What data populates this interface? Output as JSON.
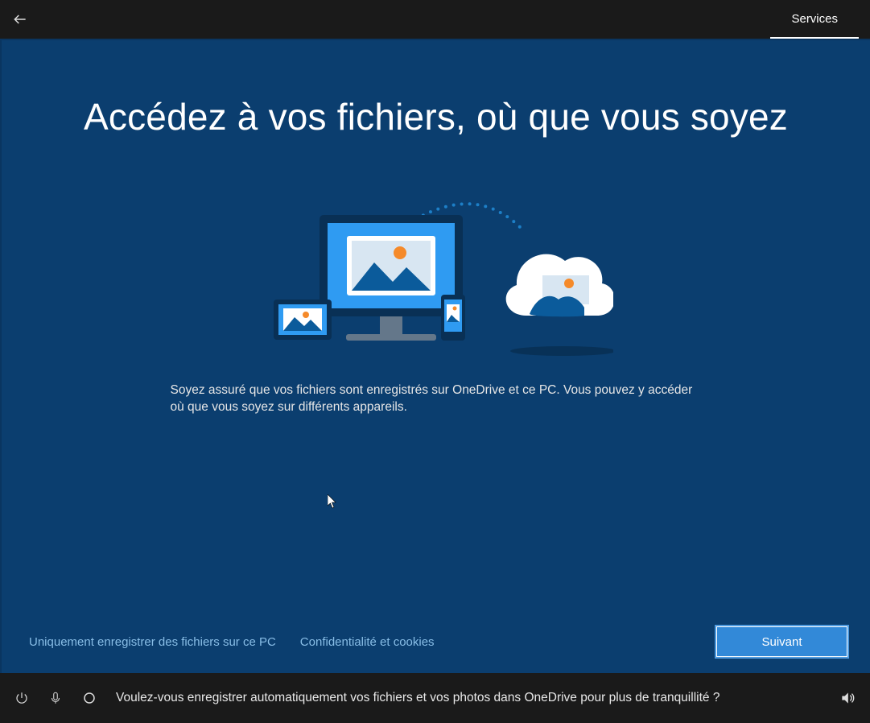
{
  "topbar": {
    "tab_label": "Services"
  },
  "main": {
    "title": "Accédez à vos fichiers, où que vous soyez",
    "description": "Soyez assuré que vos fichiers sont enregistrés sur OneDrive et ce PC. Vous pouvez y accéder où que vous soyez sur différents appareils."
  },
  "links": {
    "only_save_pc": "Uniquement enregistrer des fichiers sur ce PC",
    "privacy": "Confidentialité et cookies",
    "next": "Suivant"
  },
  "cortana": {
    "prompt": "Voulez-vous enregistrer automatiquement vos fichiers et vos photos dans OneDrive pour plus de tranquillité ?"
  }
}
